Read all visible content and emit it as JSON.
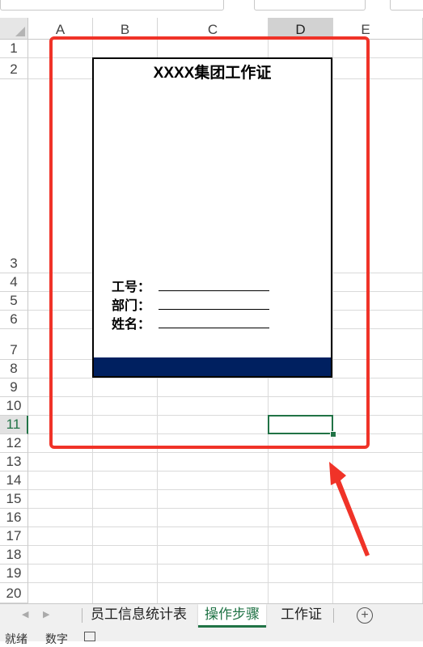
{
  "columns": [
    "A",
    "B",
    "C",
    "D",
    "E"
  ],
  "selected_column": "D",
  "rows": [
    "1",
    "2",
    "3",
    "4",
    "5",
    "6",
    "7",
    "8",
    "9",
    "10",
    "11",
    "12",
    "13",
    "14",
    "15",
    "16",
    "17",
    "18",
    "19",
    "20"
  ],
  "selected_row": "11",
  "card": {
    "title": "XXXX集团工作证",
    "fields": [
      "工号：",
      "部门：",
      "姓名："
    ],
    "bar_color": "#002060"
  },
  "highlight_color": "#f03328",
  "selection_color": "#217346",
  "sheet_tabs": [
    {
      "label": "员工信息统计表",
      "active": false
    },
    {
      "label": "操作步骤",
      "active": true
    },
    {
      "label": "工作证",
      "active": false
    }
  ],
  "add_sheet_icon": "plus-circle-icon",
  "status": {
    "mode": "就绪",
    "numlock": "数字"
  }
}
